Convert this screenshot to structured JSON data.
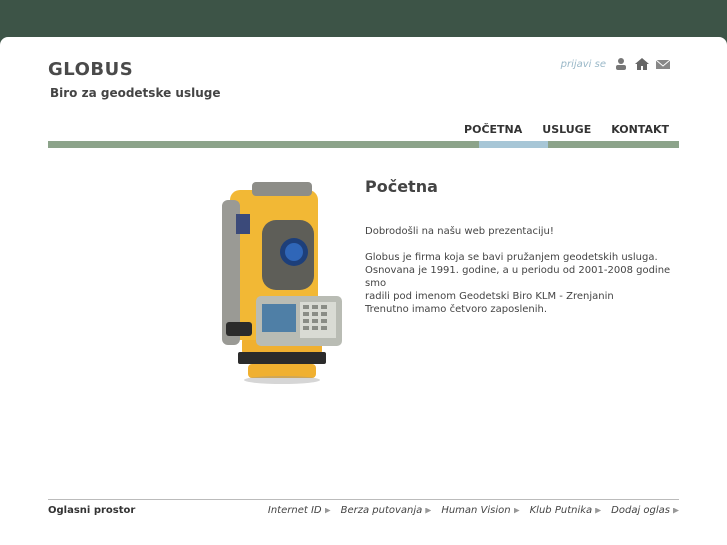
{
  "header": {
    "title": "GLOBUS",
    "subtitle": "Biro za geodetske usluge",
    "login_label": "prijavi se",
    "icons": [
      "user-icon",
      "home-icon",
      "mail-icon"
    ]
  },
  "nav": {
    "items": [
      {
        "label": "POČETNA",
        "active": true
      },
      {
        "label": "USLUGE",
        "active": false
      },
      {
        "label": "KONTAKT",
        "active": false
      }
    ]
  },
  "content": {
    "title": "Početna",
    "welcome": "Dobrodošli na našu web prezentaciju!",
    "line1": "Globus je firma koja se bavi pružanjem geodetskih usluga.",
    "line2": "Osnovana je 1991. godine, a u periodu od 2001-2008 godine smo",
    "line3": "radili pod imenom Geodetski Biro KLM - Zrenjanin",
    "line4": "Trenutno imamo četvoro zaposlenih."
  },
  "footer": {
    "label": "Oglasni prostor",
    "links": [
      "Internet ID",
      "Berza putovanja",
      "Human Vision",
      "Klub Putnika",
      "Dodaj oglas"
    ]
  },
  "colors": {
    "background": "#3d5447",
    "nav_bar": "#8ca38a",
    "nav_active": "#a7c6d6",
    "instrument_yellow": "#f0b030"
  }
}
